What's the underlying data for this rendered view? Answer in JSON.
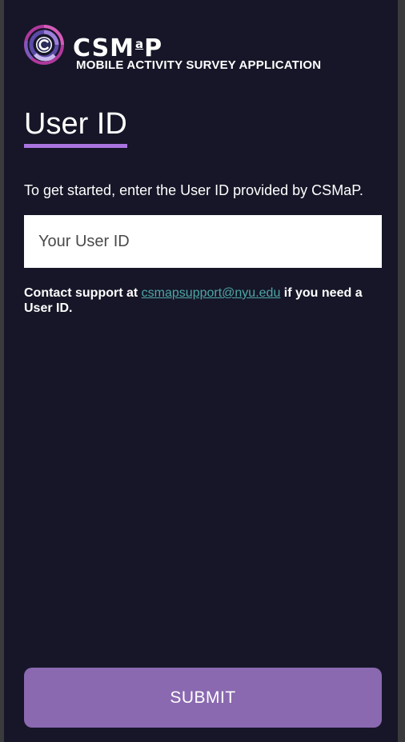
{
  "app": {
    "logo_text": "CSM",
    "logo_small_a": "a",
    "logo_text_end": "P",
    "subtitle": "MOBILE ACTIVITY SURVEY APPLICATION"
  },
  "page": {
    "title": "User ID",
    "intro": "To get started, enter the User ID provided by CSMaP."
  },
  "form": {
    "user_id_placeholder": "Your User ID",
    "user_id_value": ""
  },
  "contact": {
    "prefix": "Contact support at ",
    "email": "csmapsupport@nyu.edu",
    "suffix": " if you need a User ID."
  },
  "actions": {
    "submit_label": "SUBMIT"
  },
  "colors": {
    "background": "#161628",
    "accent": "#a974e0",
    "button": "#8a69b0",
    "link": "#4ea6a6"
  },
  "icons": {
    "logo": "csmap-logo-icon"
  }
}
